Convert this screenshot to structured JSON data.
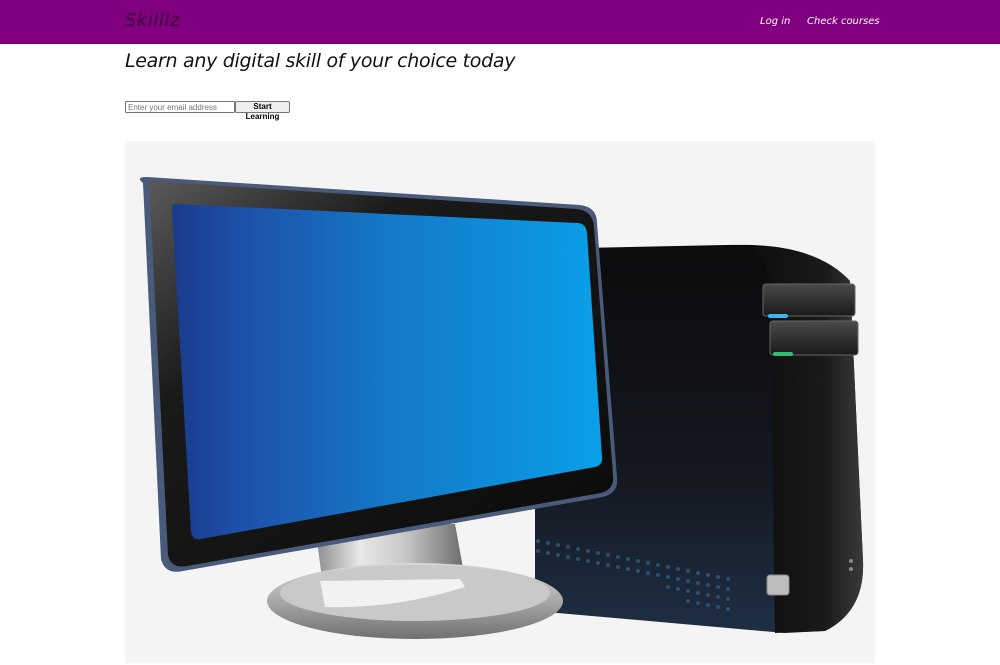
{
  "navbar": {
    "brand": "Skilllz",
    "links": [
      {
        "label": "Log in"
      },
      {
        "label": "Check courses"
      }
    ],
    "background_color": "#800080"
  },
  "hero": {
    "headline": "Learn any digital skill of your choice today",
    "email_placeholder": "Enter your email address",
    "email_value": "",
    "cta_label": "Start Learning",
    "illustration": "desktop-computer-illustration"
  }
}
